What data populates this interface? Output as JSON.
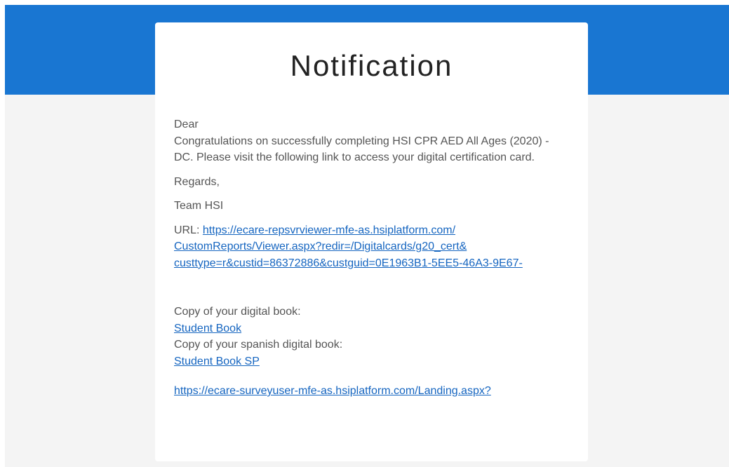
{
  "email": {
    "title": "Notification",
    "greeting": "Dear",
    "message": "Congratulations on successfully completing HSI CPR AED All Ages (2020) -DC. Please visit the following link to access your digital certification card.",
    "regards": "Regards,",
    "signature": "Team HSI",
    "url_label": "URL: ",
    "url_line1": "https://ecare-repsvrviewer-mfe-as.hsiplatform.com/",
    "url_line2": "CustomReports/Viewer.aspx?redir=/Digitalcards/g20_cert&",
    "url_line3": "custtype=r&custid=86372886&custguid=0E1963B1-5EE5-46A3-9E67-",
    "digital_book_label": "Copy of your digital book:",
    "student_book_link": "Student Book",
    "spanish_book_label": "Copy of your spanish digital book:",
    "student_book_sp_link": "Student Book SP",
    "survey_link": "https://ecare-surveyuser-mfe-as.hsiplatform.com/Landing.aspx?"
  },
  "colors": {
    "header_blue": "#1976d2",
    "link": "#1565c0",
    "background": "#f4f4f4"
  }
}
